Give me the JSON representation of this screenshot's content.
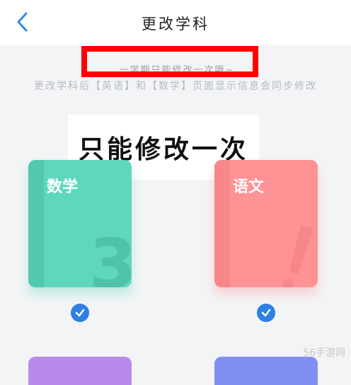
{
  "header": {
    "title": "更改学科"
  },
  "notice": "一学期只能修改一次哦~",
  "subtitle": "更改学科后【英语】和【数学】页面显示信息会同步修改",
  "annotation": "只能修改一次",
  "subjects": [
    {
      "label": "数学",
      "color": "#5fd7bd",
      "selected": true,
      "icon": "numeral-3-decoration"
    },
    {
      "label": "语文",
      "color": "#ff9295",
      "selected": true,
      "icon": "exclamation-decoration"
    }
  ],
  "watermark": "56手游网",
  "colors": {
    "accent": "#2e7fe6",
    "highlight_box": "#ff0000"
  }
}
